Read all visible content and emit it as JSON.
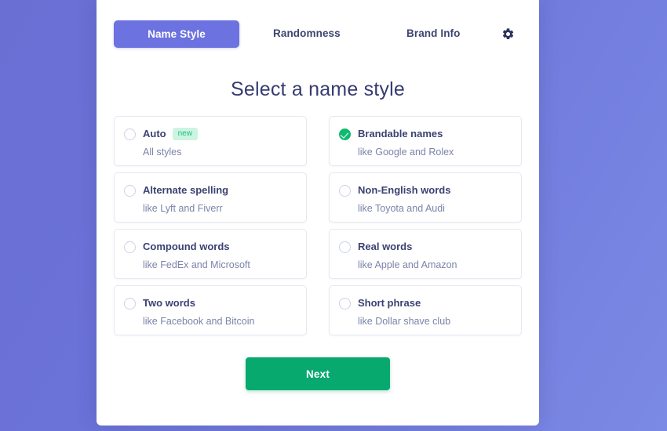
{
  "background": {
    "gradient_from": "#6a6fd4",
    "gradient_to": "#7b8ae4"
  },
  "tabs": [
    {
      "label": "Name Style",
      "active": true
    },
    {
      "label": "Randomness",
      "active": false
    },
    {
      "label": "Brand Info",
      "active": false
    }
  ],
  "settings_icon": "gear-icon",
  "heading": "Select a name style",
  "options": [
    {
      "title": "Auto",
      "subtitle": "All styles",
      "badge": "new",
      "selected": false
    },
    {
      "title": "Brandable names",
      "subtitle": "like Google and Rolex",
      "badge": "",
      "selected": true
    },
    {
      "title": "Alternate spelling",
      "subtitle": "like Lyft and Fiverr",
      "badge": "",
      "selected": false
    },
    {
      "title": "Non-English words",
      "subtitle": "like Toyota and Audi",
      "badge": "",
      "selected": false
    },
    {
      "title": "Compound words",
      "subtitle": "like FedEx and Microsoft",
      "badge": "",
      "selected": false
    },
    {
      "title": "Real words",
      "subtitle": "like Apple and Amazon",
      "badge": "",
      "selected": false
    },
    {
      "title": "Two words",
      "subtitle": "like Facebook and Bitcoin",
      "badge": "",
      "selected": false
    },
    {
      "title": "Short phrase",
      "subtitle": "like Dollar shave club",
      "badge": "",
      "selected": false
    }
  ],
  "next_button": {
    "label": "Next",
    "color": "#07a96f"
  },
  "accent": {
    "active_tab": "#6c72e0",
    "selected_check": "#0fb96f",
    "badge_bg": "#cdf4e3",
    "badge_text": "#1bbd7a"
  }
}
